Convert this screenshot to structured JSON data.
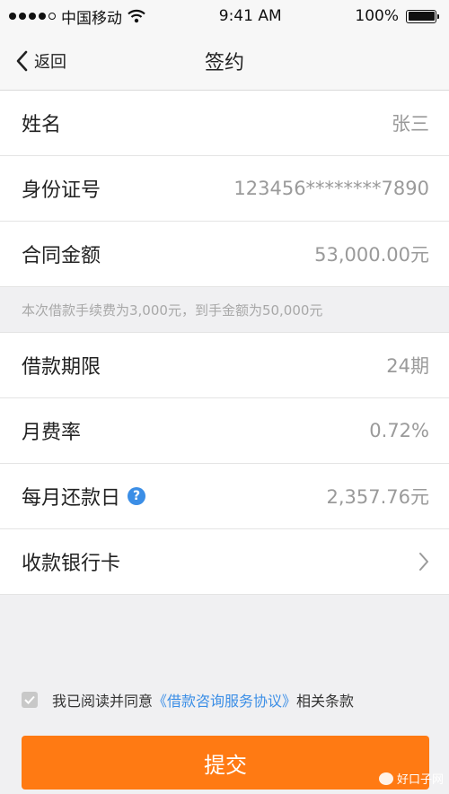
{
  "status_bar": {
    "carrier": "中国移动",
    "time": "9:41 AM",
    "battery": "100%"
  },
  "nav": {
    "back_label": "返回",
    "title": "签约"
  },
  "rows_top": [
    {
      "label": "姓名",
      "value": "张三"
    },
    {
      "label": "身份证号",
      "value": "123456********7890"
    },
    {
      "label": "合同金额",
      "value": "53,000.00元"
    }
  ],
  "fee_note": "本次借款手续费为3,000元，到手金额为50,000元",
  "rows_bottom": [
    {
      "label": "借款期限",
      "value": "24期"
    },
    {
      "label": "月费率",
      "value": "0.72%"
    },
    {
      "label": "每月还款日",
      "value": "2,357.76元"
    },
    {
      "label": "收款银行卡",
      "value": ""
    }
  ],
  "agreement": {
    "prefix": "我已阅读并同意",
    "link": "《借款咨询服务协议》",
    "suffix": "相关条款"
  },
  "submit_label": "提交",
  "watermark": "好口子网",
  "colors": {
    "accent": "#ff7a13",
    "link": "#3b8ee6"
  }
}
